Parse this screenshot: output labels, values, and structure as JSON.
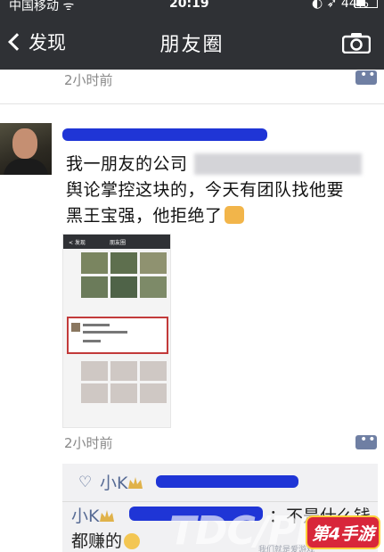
{
  "status_bar": {
    "carrier": "中国移动 ᯤ",
    "time": "20:19",
    "battery": "◐ ➶ 44%",
    "battery_level": 0.44
  },
  "nav": {
    "back_label": "发现",
    "title": "朋友圈",
    "camera_icon": "camera-icon"
  },
  "feed": {
    "prev_time": "2小时前",
    "post": {
      "text_lines": [
        "我一朋友的公司",
        "舆论掌控这块的，今天有团队找他要",
        "黑王宝强，他拒绝了"
      ],
      "time": "2小时前",
      "embedded_screenshot": {
        "back": "< 发现",
        "title": "朋友圈"
      },
      "likes": {
        "name": "小K"
      },
      "comment": {
        "author": "小K",
        "text_part1": "：不是什么钱",
        "text_part2": "都赚的"
      }
    }
  },
  "watermark": {
    "text": "TDC/PE",
    "sub": "我们就是爱游戏",
    "logo": "第4手游"
  },
  "colors": {
    "nav_bg": "#2f3135",
    "link_blue": "#576b95",
    "redact_blue": "#1f35d6"
  }
}
